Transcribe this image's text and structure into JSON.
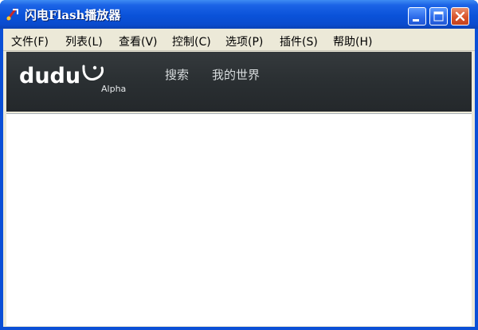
{
  "window": {
    "title": "闪电Flash播放器",
    "colors": {
      "titlebar": "#0a52d9",
      "frame": "#0a4fd6",
      "close_button": "#d9542b"
    }
  },
  "menu": {
    "items": [
      {
        "label": "文件(F)"
      },
      {
        "label": "列表(L)"
      },
      {
        "label": "查看(V)"
      },
      {
        "label": "控制(C)"
      },
      {
        "label": "选项(P)"
      },
      {
        "label": "插件(S)"
      },
      {
        "label": "帮助(H)"
      }
    ]
  },
  "toolbar": {
    "logo_text": "dudu",
    "logo_badge": "Alpha",
    "links": [
      {
        "label": "搜索"
      },
      {
        "label": "我的世界"
      }
    ],
    "colors": {
      "background": "#2a2f32",
      "link": "#d8dcde"
    }
  }
}
